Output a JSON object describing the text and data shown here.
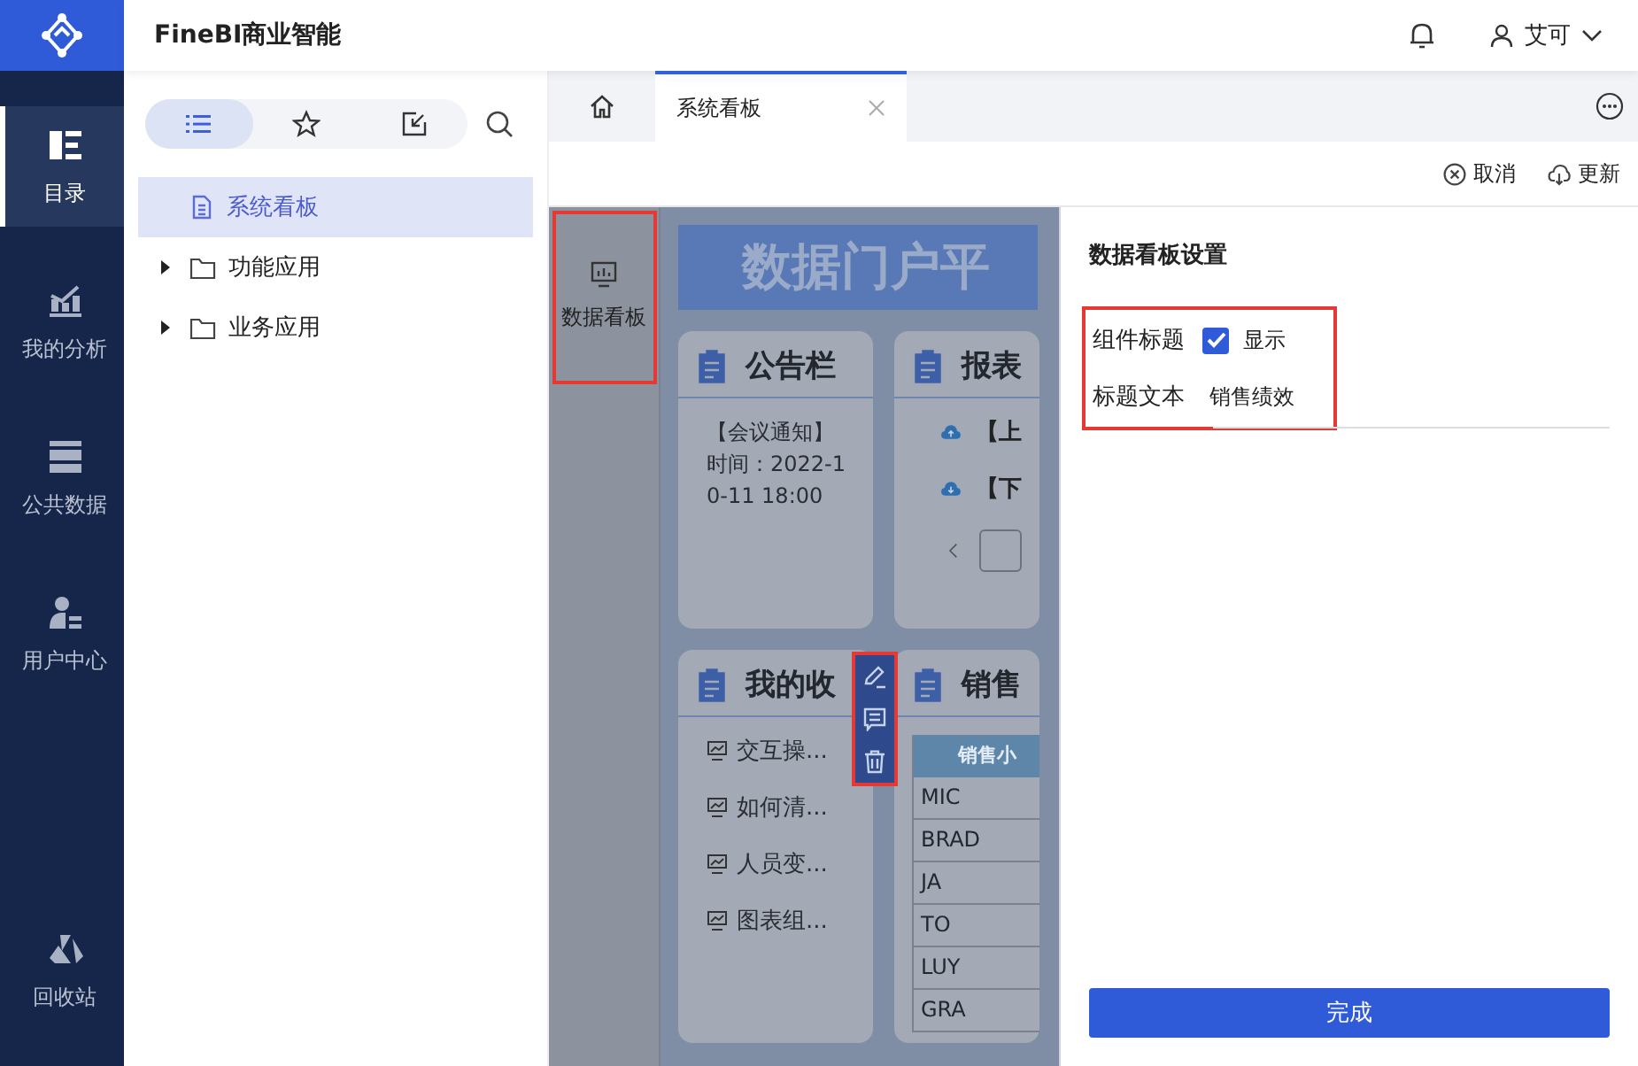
{
  "app": {
    "title": "FineBI商业智能",
    "user": "艾可"
  },
  "nav": [
    {
      "label": "目录",
      "kind": "catalog",
      "selected": true
    },
    {
      "label": "我的分析",
      "kind": "analysis",
      "selected": false
    },
    {
      "label": "公共数据",
      "kind": "data",
      "selected": false
    },
    {
      "label": "用户中心",
      "kind": "user",
      "selected": false
    },
    {
      "label": "回收站",
      "kind": "recycle",
      "selected": false
    }
  ],
  "directory": {
    "tabs": [
      {
        "kind": "list",
        "selected": true
      },
      {
        "kind": "star",
        "selected": false
      },
      {
        "kind": "import",
        "selected": false
      }
    ],
    "tree": [
      {
        "label": "系统看板",
        "kind": "file",
        "selected": true
      },
      {
        "label": "功能应用",
        "kind": "folder",
        "expanded": false,
        "selected": false
      },
      {
        "label": "业务应用",
        "kind": "folder",
        "expanded": false,
        "selected": false
      }
    ]
  },
  "tabs": [
    {
      "label": "系统看板",
      "selected": true
    }
  ],
  "toolbar": [
    {
      "kind": "cancel",
      "label": "取消"
    },
    {
      "kind": "refresh",
      "label": "更新"
    }
  ],
  "side_strip": {
    "label": "数据看板"
  },
  "dashboard": {
    "banner": "数据门户平",
    "notice": {
      "title": "公告栏",
      "text": "【会议通知】时间：2022-10-11 18:00"
    },
    "report": {
      "title": "报表",
      "items": [
        {
          "kind": "upload",
          "label": "【上"
        },
        {
          "kind": "download",
          "label": "【下"
        }
      ]
    },
    "favorites": {
      "title": "我的收",
      "items": [
        "交互操...",
        "如何清...",
        "人员变...",
        "图表组..."
      ]
    },
    "sales": {
      "title": "销售",
      "column": "销售小",
      "rows": [
        "MIC",
        "BRAD",
        "JA",
        "TO",
        "LUY",
        "GRA"
      ]
    }
  },
  "settings": {
    "title": "数据看板设置",
    "component_title": {
      "label": "组件标题",
      "checked": true,
      "option": "显示"
    },
    "title_text": {
      "label": "标题文本",
      "value": "销售绩效"
    },
    "done": "完成"
  }
}
